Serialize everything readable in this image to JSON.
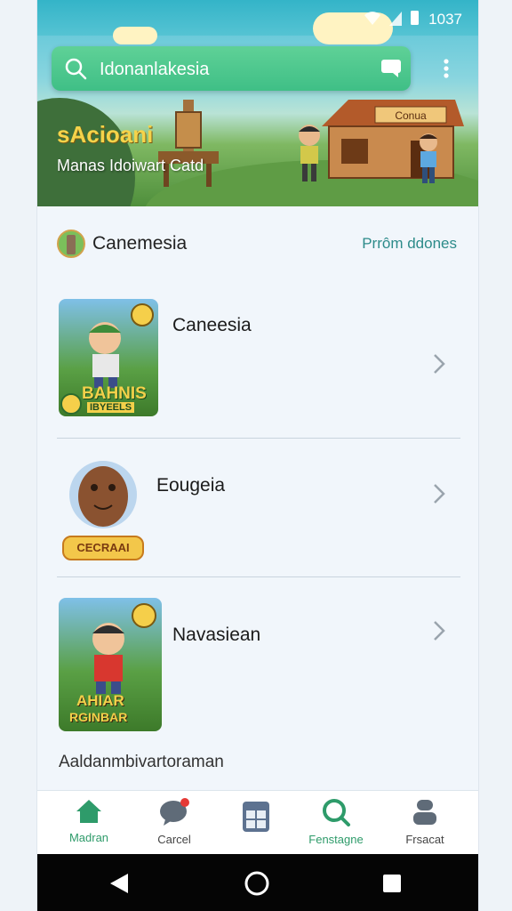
{
  "status_bar": {
    "time": "1037"
  },
  "search": {
    "value": "Idonanlakesia"
  },
  "hero": {
    "title": "sAcioani",
    "subtitle": "Manas Idoiwart Catd",
    "house_sign": "Conua"
  },
  "section": {
    "title": "Canemesia",
    "link": "Prrôm ddones"
  },
  "list_items": [
    {
      "label": "Caneesia",
      "thumb_text_line1": "BAHNIS",
      "thumb_text_line2": "IBYEELS"
    },
    {
      "label": "Eougeia",
      "thumb_text_line1": "CECRAAI"
    },
    {
      "label": "Navasiean",
      "thumb_text_line1": "AHIAR",
      "thumb_text_line2": "RGINBAR"
    }
  ],
  "footer_text": "Aaldanmbivartoraman",
  "bottom_nav": [
    {
      "label": "Madran",
      "icon": "home-icon"
    },
    {
      "label": "Carcel",
      "icon": "chat-bubble-icon"
    },
    {
      "label": "",
      "icon": "calendar-icon"
    },
    {
      "label": "Fenstagne",
      "icon": "search-icon"
    },
    {
      "label": "Frsacat",
      "icon": "profile-icon"
    }
  ],
  "colors": {
    "accent": "#3fbf86",
    "nav_active": "#2e9b6a",
    "link": "#2d8b8a"
  }
}
